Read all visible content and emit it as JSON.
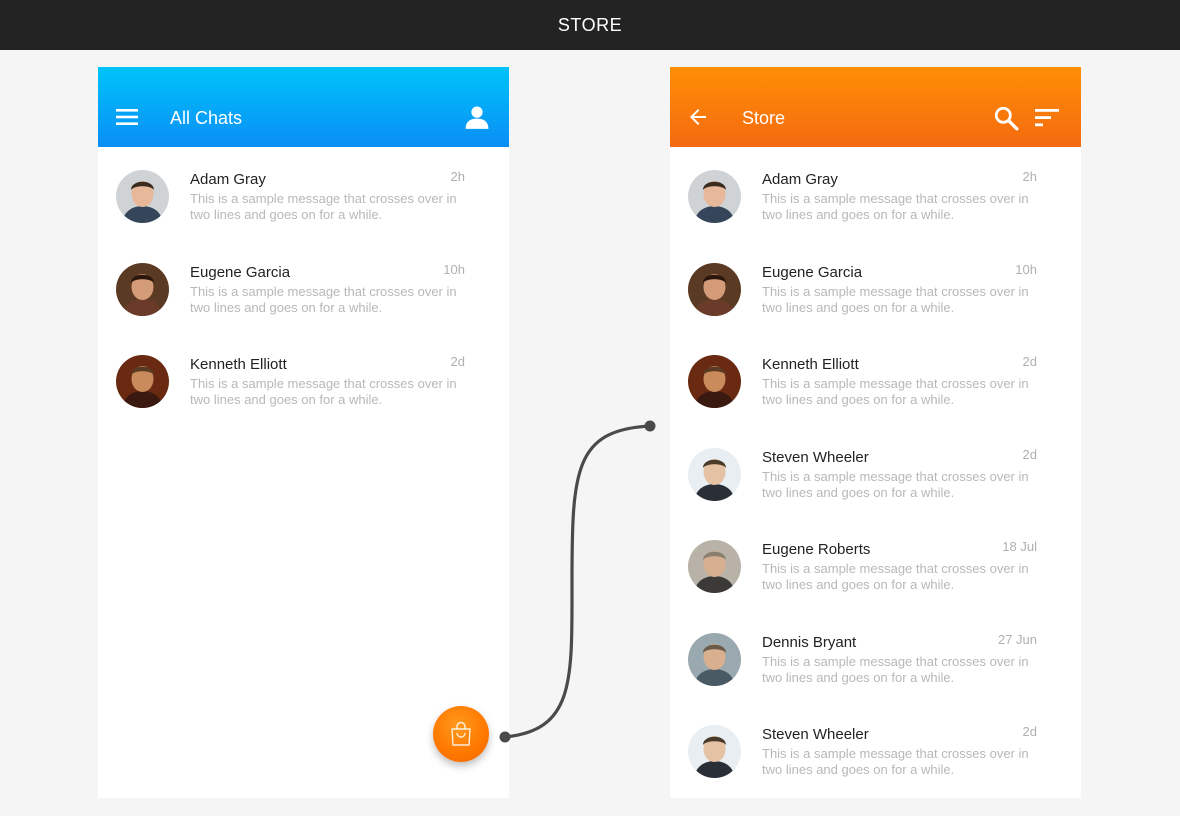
{
  "topbar": {
    "title": "STORE"
  },
  "left_screen": {
    "title": "All Chats",
    "chats": [
      {
        "name": "Adam Gray",
        "time": "2h",
        "message": "This is a sample message that crosses over in two lines and goes on for a while."
      },
      {
        "name": "Eugene Garcia",
        "time": "10h",
        "message": "This is a sample message that crosses over in two lines and goes on for a while."
      },
      {
        "name": "Kenneth Elliott",
        "time": "2d",
        "message": "This is a sample message that crosses over in two lines and goes on for a while."
      }
    ]
  },
  "right_screen": {
    "title": "Store",
    "chats": [
      {
        "name": "Adam Gray",
        "time": "2h",
        "message": "This is a sample message that crosses over in two lines and goes on for a while."
      },
      {
        "name": "Eugene Garcia",
        "time": "10h",
        "message": "This is a sample message that crosses over in two lines and goes on for a while."
      },
      {
        "name": "Kenneth Elliott",
        "time": "2d",
        "message": "This is a sample message that crosses over in two lines and goes on for a while."
      },
      {
        "name": "Steven Wheeler",
        "time": "2d",
        "message": "This is a sample message that crosses over in two lines and goes on for a while."
      },
      {
        "name": "Eugene Roberts",
        "time": "18 Jul",
        "message": "This is a sample message that crosses over in two lines and goes on for a while."
      },
      {
        "name": "Dennis Bryant",
        "time": "27 Jun",
        "message": "This is a sample message that crosses over in two lines and goes on for a while."
      },
      {
        "name": "Steven Wheeler",
        "time": "2d",
        "message": "This is a sample message that crosses over in two lines and goes on for a while."
      }
    ]
  },
  "icons": {
    "left_appbar": [
      "menu-icon",
      "account-icon"
    ],
    "right_appbar": [
      "back-arrow-icon",
      "search-icon",
      "sort-icon"
    ],
    "fab": "shopping-bag-icon"
  },
  "colors": {
    "topbar": "#232323",
    "blue_header_top": "#00c4fb",
    "blue_header_bottom": "#0a8ef5",
    "orange_header_top": "#ff8f06",
    "orange_header_bottom": "#f46a10",
    "fab": "#ff7a00",
    "connector": "#4a4a4a"
  }
}
